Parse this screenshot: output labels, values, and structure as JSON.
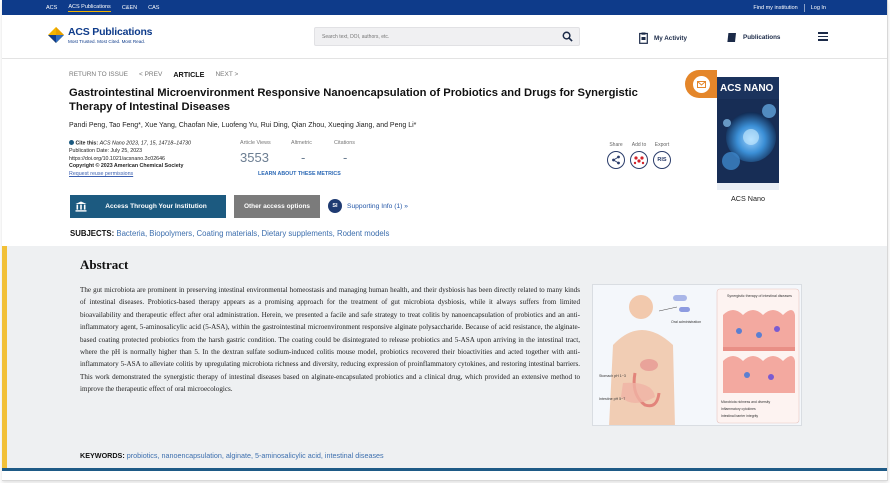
{
  "topbar": {
    "links": [
      "ACS",
      "ACS Publications",
      "C&EN",
      "CAS"
    ],
    "right": [
      "Find my institution",
      "Log In"
    ]
  },
  "header": {
    "logo_name": "ACS Publications",
    "logo_tagline": "Most Trusted. Most Cited. Most Read.",
    "search_placeholder": "Search text, DOI, authors, etc.",
    "my_activity": "My Activity",
    "publications": "Publications"
  },
  "article_nav": {
    "return": "RETURN TO ISSUE",
    "prev": "< PREV",
    "current": "ARTICLE",
    "next": "NEXT >"
  },
  "article": {
    "title": "Gastrointestinal Microenvironment Responsive Nanoencapsulation of Probiotics and Drugs for Synergistic Therapy of Intestinal Diseases",
    "authors": "Pandi Peng, Tao Feng*, Xue Yang, Chaofan Nie, Luofeng Yu, Rui Ding, Qian Zhou, Xueqing Jiang, and Peng Li*",
    "cite_label": "Cite this:",
    "cite_ref": "ACS Nano 2023, 17, 15, 14718–14730",
    "pub_date": "Publication Date: July 25, 2023",
    "doi": "https://doi.org/10.1021/acsnano.3c02646",
    "copyright": "Copyright © 2023 American Chemical Society",
    "permissions": "Request reuse permissions"
  },
  "metrics": {
    "views_label": "Article Views",
    "views_value": "3553",
    "altmetric_label": "Altmetric",
    "altmetric_value": "-",
    "citations_label": "Citations",
    "citations_value": "-",
    "learn_more": "LEARN ABOUT THESE METRICS"
  },
  "tools": {
    "share": "Share",
    "add_to": "Add to",
    "export": "Export",
    "export_badge": "RIS"
  },
  "actions": {
    "access": "Access Through Your Institution",
    "other": "Other access options",
    "si_badge": "SI",
    "supporting": "Supporting Info (1) »"
  },
  "subjects": {
    "label": "SUBJECTS:",
    "items": "Bacteria, Biopolymers, Coating materials, Dietary supplements, Rodent models"
  },
  "journal": {
    "cover_title": "ACS NANO",
    "label": "ACS Nano"
  },
  "abstract": {
    "title": "Abstract",
    "text": "The gut microbiota are prominent in preserving intestinal environmental homeostasis and managing human health, and their dysbiosis has been directly related to many kinds of intestinal diseases. Probiotics-based therapy appears as a promising approach for the treatment of gut microbiota dysbiosis, while it always suffers from limited bioavailability and therapeutic effect after oral administration. Herein, we presented a facile and safe strategy to treat colitis by nanoencapsulation of probiotics and an anti-inflammatory agent, 5-aminosalicylic acid (5-ASA), within the gastrointestinal microenvironment responsive alginate polysaccharide. Because of acid resistance, the alginate-based coating protected probiotics from the harsh gastric condition. The coating could be disintegrated to release probiotics and 5-ASA upon arriving in the intestinal tract, where the pH is normally higher than 5. In the dextran sulfate sodium-induced colitis mouse model, probiotics recovered their bioactivities and acted together with anti-inflammatory 5-ASA to alleviate colitis by upregulating microbiota richness and diversity, reducing expression of proinflammatory cytokines, and restoring intestinal barriers. This work demonstrated the synergistic therapy of intestinal diseases based on alginate-encapsulated probiotics and a clinical drug, which provided an extensive method to improve the therapeutic effect of oral microecologics."
  },
  "toc_graphic": {
    "oral": "Oral administration",
    "stomach": "Stomach pH 1~3",
    "intestine": "Intestine pH 5~7",
    "synergistic": "Synergistic therapy of intestinal diseases",
    "outcome1": "Microbiota richness and diversity",
    "outcome2": "Inflammatory cytokines",
    "outcome3": "Intestinal barrier integrity"
  },
  "keywords": {
    "label": "KEYWORDS:",
    "items": "probiotics, nanoencapsulation, alginate, 5-aminosalicylic acid, intestinal diseases"
  }
}
